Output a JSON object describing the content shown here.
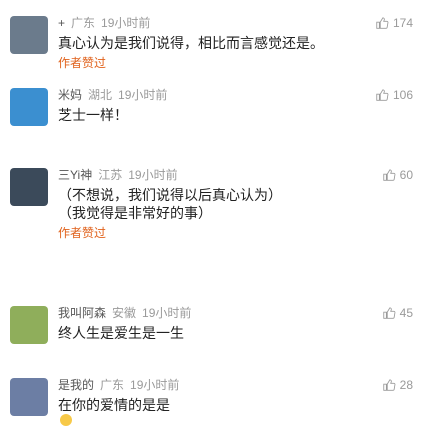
{
  "comments": [
    {
      "name": "+",
      "location": "广东",
      "time": "19小时前",
      "likes": "174",
      "lines": [
        "真心认为是我们说得，相比而言感觉还是。"
      ],
      "author_tag": "作者赞过",
      "avatar_color": "#6b7b8c"
    },
    {
      "name": "米妈",
      "location": "湖北",
      "time": "19小时前",
      "likes": "106",
      "lines": [
        "芝士一样！"
      ],
      "author_tag": "",
      "avatar_color": "#3b8fd0"
    },
    {
      "name": "三Yi神",
      "location": "江苏",
      "time": "19小时前",
      "likes": "60",
      "lines": [
        "（不想说，我们说得以后真心认为）",
        "（我觉得是非常好的事）"
      ],
      "author_tag": "作者赞过",
      "avatar_color": "#3b4a5a"
    },
    {
      "name": "我叫阿森",
      "location": "安徽",
      "time": "19小时前",
      "likes": "45",
      "lines": [
        "终人生是爱生是一生"
      ],
      "author_tag": "",
      "avatar_color": "#8fae5b"
    },
    {
      "name": "是我的",
      "location": "广东",
      "time": "19小时前",
      "likes": "28",
      "lines": [
        "在你的爱情的是是"
      ],
      "author_tag": "",
      "avatar_color": "#6c7ea4"
    }
  ]
}
